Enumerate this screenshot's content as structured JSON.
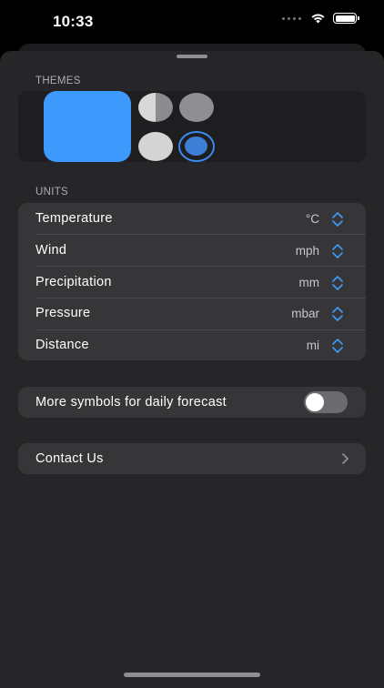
{
  "status_bar": {
    "time": "10:33"
  },
  "themes": {
    "header": "THEMES",
    "options": [
      "theme-blue-large",
      "theme-half",
      "theme-grey",
      "theme-light",
      "theme-blue-selected"
    ],
    "selected_color": "#3d99fc"
  },
  "units": {
    "header": "UNITS",
    "rows": [
      {
        "label": "Temperature",
        "value": "°C"
      },
      {
        "label": "Wind",
        "value": "mph"
      },
      {
        "label": "Precipitation",
        "value": "mm"
      },
      {
        "label": "Pressure",
        "value": "mbar"
      },
      {
        "label": "Distance",
        "value": "mi"
      }
    ]
  },
  "toggle": {
    "label": "More symbols for daily forecast",
    "on": false
  },
  "contact": {
    "label": "Contact Us"
  },
  "colors": {
    "accent": "#3d99fc",
    "background": "#262628",
    "card": "#363638"
  }
}
